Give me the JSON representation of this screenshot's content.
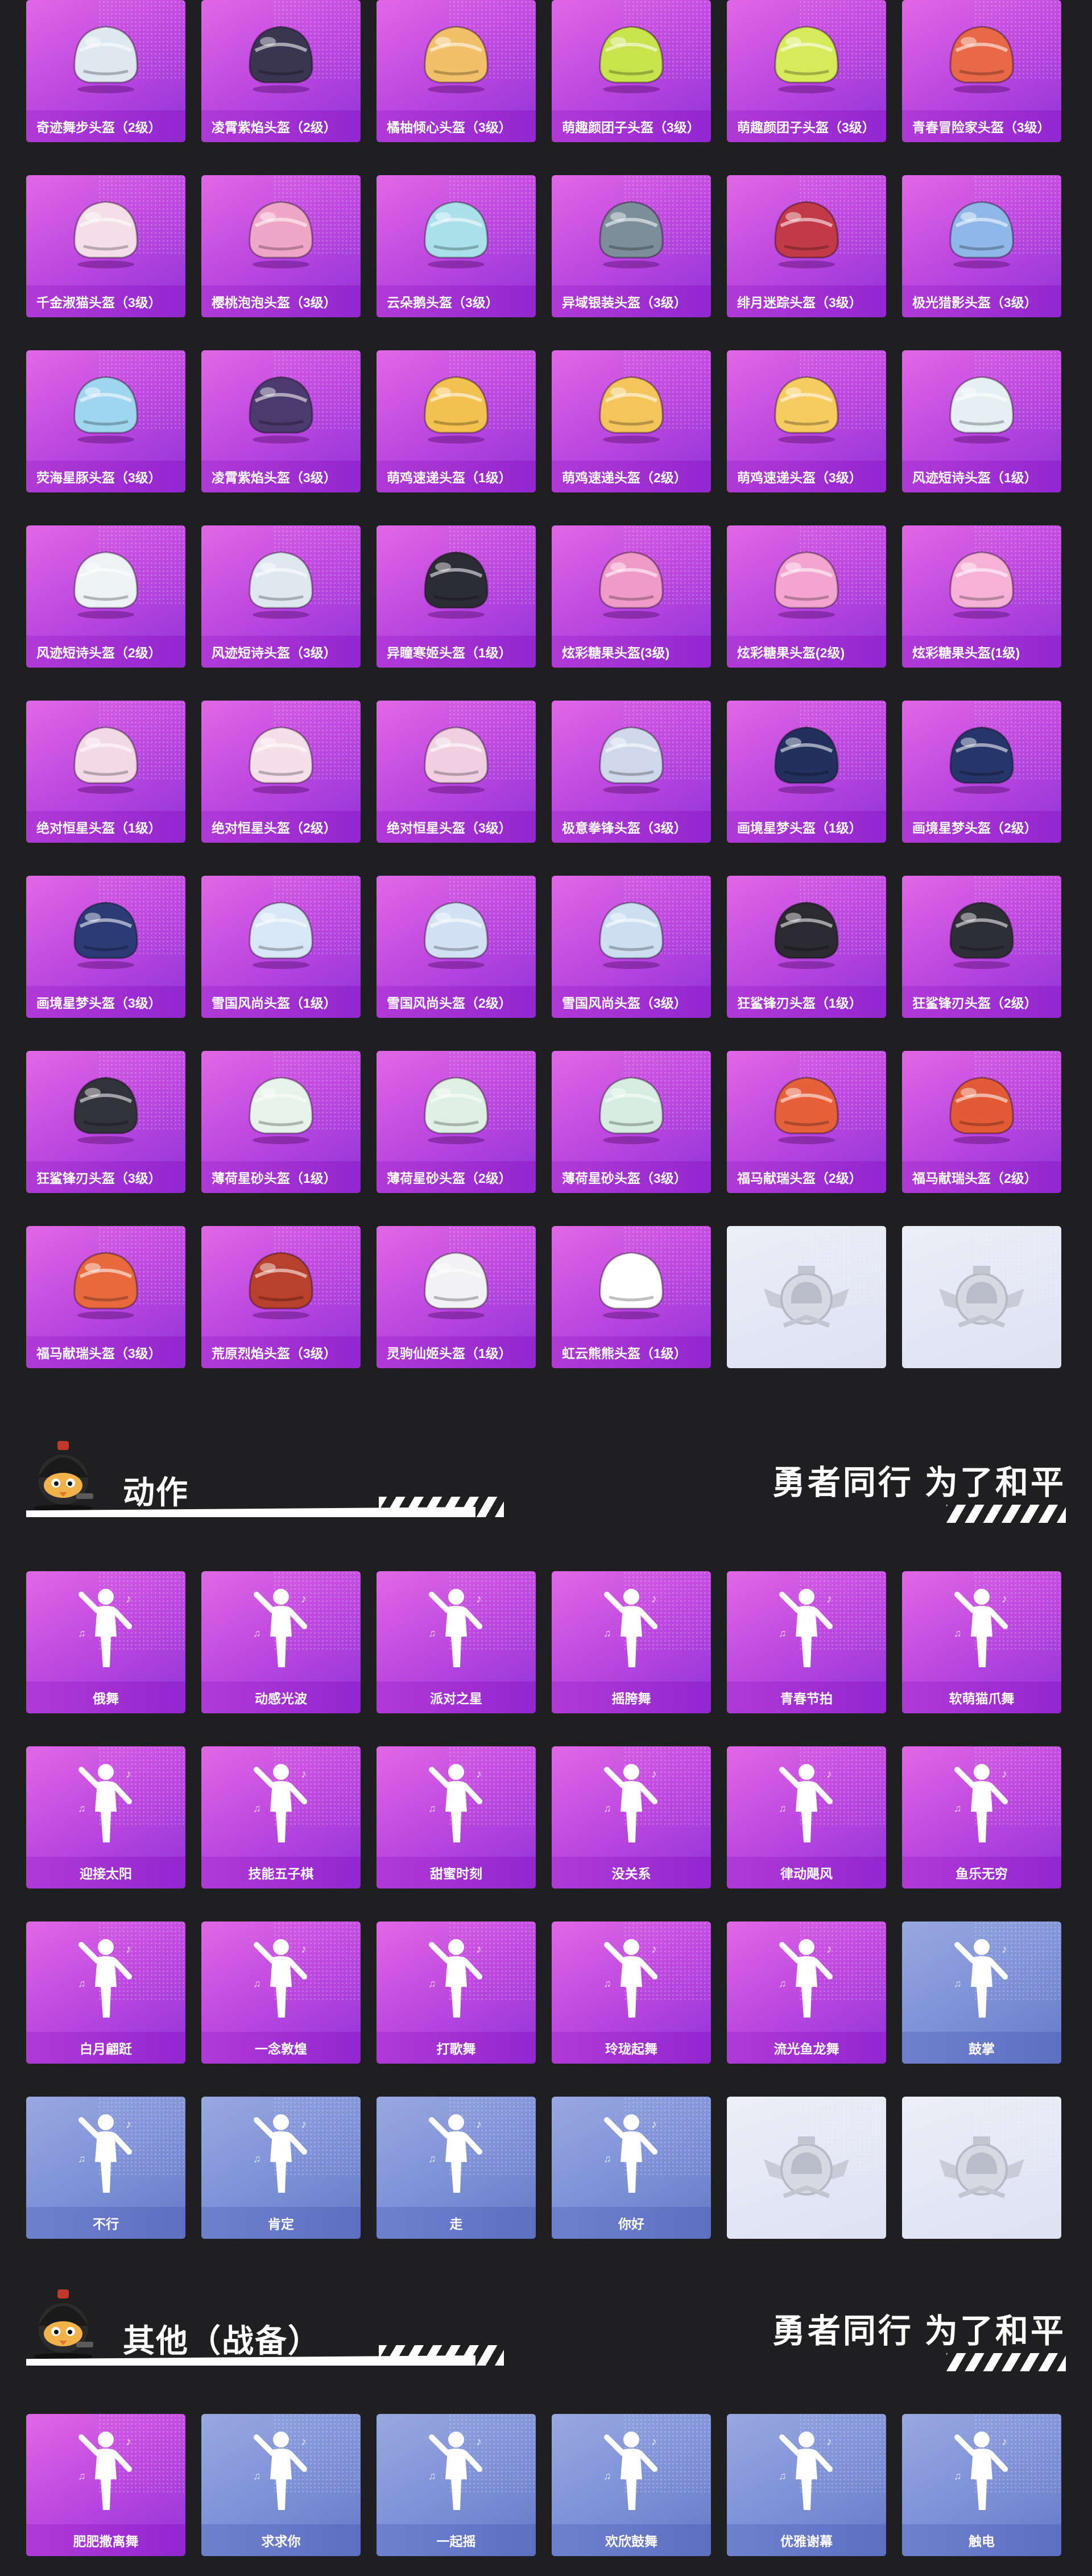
{
  "helmets": [
    {
      "label": "奇迹舞步头盔（2级）",
      "icon": "helmet-icon",
      "color": "#dfe8ef"
    },
    {
      "label": "凌霄紫焰头盔（2级）",
      "icon": "helmet-icon",
      "color": "#3a3550"
    },
    {
      "label": "橘柚倾心头盔（3级）",
      "icon": "helmet-icon",
      "color": "#f3c06a"
    },
    {
      "label": "萌趣颜团子头盔（3级）",
      "icon": "helmet-icon",
      "color": "#c9e34c"
    },
    {
      "label": "萌趣颜团子头盔（3级）",
      "icon": "helmet-icon",
      "color": "#d7ea5a"
    },
    {
      "label": "青春冒险家头盔（3级）",
      "icon": "helmet-icon",
      "color": "#e86848"
    },
    {
      "label": "千金淑猫头盔（3级）",
      "icon": "helmet-icon",
      "color": "#f4dfe8"
    },
    {
      "label": "樱桃泡泡头盔（3级）",
      "icon": "helmet-icon",
      "color": "#f0a6c6"
    },
    {
      "label": "云朵鹅头盔（3级）",
      "icon": "helmet-icon",
      "color": "#a9e0ea"
    },
    {
      "label": "异域银装头盔（3级）",
      "icon": "helmet-icon",
      "color": "#7b8e9a"
    },
    {
      "label": "绯月迷踪头盔（3级）",
      "icon": "helmet-icon",
      "color": "#c23a48"
    },
    {
      "label": "极光猎影头盔（3级）",
      "icon": "helmet-icon",
      "color": "#8fb7e8"
    },
    {
      "label": "荧海星豚头盔（3级）",
      "icon": "helmet-icon",
      "color": "#9fd6ef"
    },
    {
      "label": "凌霄紫焰头盔（3级）",
      "icon": "helmet-icon",
      "color": "#4a3a6e"
    },
    {
      "label": "萌鸡速递头盔（1级）",
      "icon": "helmet-icon",
      "color": "#f2c14f"
    },
    {
      "label": "萌鸡速递头盔（2级）",
      "icon": "helmet-icon",
      "color": "#f4c55a"
    },
    {
      "label": "萌鸡速递头盔（3级）",
      "icon": "helmet-icon",
      "color": "#f6cb60"
    },
    {
      "label": "风迹短诗头盔（1级）",
      "icon": "helmet-icon",
      "color": "#e6f0f2"
    },
    {
      "label": "风迹短诗头盔（2级）",
      "icon": "helmet-icon",
      "color": "#edf2f4"
    },
    {
      "label": "风迹短诗头盔（3级）",
      "icon": "helmet-icon",
      "color": "#dfe8f0"
    },
    {
      "label": "异瞳寒姬头盔（1级）",
      "icon": "helmet-icon",
      "color": "#2c2c34"
    },
    {
      "label": "炫彩糖果头盔(3级)",
      "icon": "helmet-icon",
      "color": "#f09ac8"
    },
    {
      "label": "炫彩糖果头盔(2级)",
      "icon": "helmet-icon",
      "color": "#f3a5cf"
    },
    {
      "label": "炫彩糖果头盔(1级)",
      "icon": "helmet-icon",
      "color": "#f6b1d6"
    },
    {
      "label": "绝对恒星头盔（1级）",
      "icon": "helmet-icon",
      "color": "#f3d9e6"
    },
    {
      "label": "绝对恒星头盔（2级）",
      "icon": "helmet-icon",
      "color": "#f5dfe9"
    },
    {
      "label": "绝对恒星头盔（3级）",
      "icon": "helmet-icon",
      "color": "#f0d0e0"
    },
    {
      "label": "极意拳锋头盔（3级）",
      "icon": "helmet-icon",
      "color": "#cfd8ea"
    },
    {
      "label": "画境星梦头盔（1级）",
      "icon": "helmet-icon",
      "color": "#22305e"
    },
    {
      "label": "画境星梦头盔（2级）",
      "icon": "helmet-icon",
      "color": "#26356a"
    },
    {
      "label": "画境星梦头盔（3级）",
      "icon": "helmet-icon",
      "color": "#2a3b76"
    },
    {
      "label": "雪国风尚头盔（1级）",
      "icon": "helmet-icon",
      "color": "#d8e6f6"
    },
    {
      "label": "雪国风尚头盔（2级）",
      "icon": "helmet-icon",
      "color": "#d2e2f4"
    },
    {
      "label": "雪国风尚头盔（3级）",
      "icon": "helmet-icon",
      "color": "#ccdef2"
    },
    {
      "label": "狂鲨锋刃头盔（1级）",
      "icon": "helmet-icon",
      "color": "#2a2a30"
    },
    {
      "label": "狂鲨锋刃头盔（2级）",
      "icon": "helmet-icon",
      "color": "#2e2e36"
    },
    {
      "label": "狂鲨锋刃头盔（3级）",
      "icon": "helmet-icon",
      "color": "#32323a"
    },
    {
      "label": "薄荷星砂头盔（1级）",
      "icon": "helmet-icon",
      "color": "#e6f2ea"
    },
    {
      "label": "薄荷星砂头盔（2级）",
      "icon": "helmet-icon",
      "color": "#dfefe4"
    },
    {
      "label": "薄荷星砂头盔（3级）",
      "icon": "helmet-icon",
      "color": "#d6ece0"
    },
    {
      "label": "福马献瑞头盔（2级）",
      "icon": "helmet-icon",
      "color": "#e6603a"
    },
    {
      "label": "福马献瑞头盔（2级）",
      "icon": "helmet-icon",
      "color": "#e35a36"
    },
    {
      "label": "福马献瑞头盔（3级）",
      "icon": "helmet-icon",
      "color": "#e86a3c"
    },
    {
      "label": "荒原烈焰头盔（3级）",
      "icon": "helmet-icon",
      "color": "#b8402c"
    },
    {
      "label": "灵驹仙姬头盔（1级）",
      "icon": "helmet-icon",
      "color": "#f2f2f4"
    },
    {
      "label": "虹云熊熊头盔（1级）",
      "icon": "helmet-icon",
      "color": "#ffffff"
    },
    {
      "label": "",
      "icon": "emblem-icon",
      "color": "#c6cad6",
      "blank": true
    },
    {
      "label": "",
      "icon": "emblem-icon",
      "color": "#c6cad6",
      "blank": true
    }
  ],
  "sections": {
    "emotes": {
      "title": "动作",
      "slogan": "勇者同行 为了和平",
      "mascot_icon": "mascot-icon"
    },
    "other": {
      "title": "其他（战备）",
      "slogan": "勇者同行 为了和平",
      "mascot_icon": "mascot-icon"
    }
  },
  "emotes": [
    {
      "label": "俄舞",
      "style": "purple"
    },
    {
      "label": "动感光波",
      "style": "purple"
    },
    {
      "label": "派对之星",
      "style": "purple"
    },
    {
      "label": "摇胯舞",
      "style": "purple"
    },
    {
      "label": "青春节拍",
      "style": "purple"
    },
    {
      "label": "软萌猫爪舞",
      "style": "purple"
    },
    {
      "label": "迎接太阳",
      "style": "purple"
    },
    {
      "label": "技能五子棋",
      "style": "purple"
    },
    {
      "label": "甜蜜时刻",
      "style": "purple"
    },
    {
      "label": "没关系",
      "style": "purple"
    },
    {
      "label": "律动飓风",
      "style": "purple"
    },
    {
      "label": "鱼乐无穷",
      "style": "purple"
    },
    {
      "label": "白月翩跹",
      "style": "purple"
    },
    {
      "label": "一念敦煌",
      "style": "purple"
    },
    {
      "label": "打歌舞",
      "style": "purple"
    },
    {
      "label": "玲珑起舞",
      "style": "purple"
    },
    {
      "label": "流光鱼龙舞",
      "style": "purple"
    },
    {
      "label": "鼓掌",
      "style": "blue"
    },
    {
      "label": "不行",
      "style": "blue"
    },
    {
      "label": "肯定",
      "style": "blue"
    },
    {
      "label": "走",
      "style": "blue"
    },
    {
      "label": "你好",
      "style": "blue"
    },
    {
      "label": "",
      "style": "blank"
    },
    {
      "label": "",
      "style": "blank"
    }
  ],
  "other_items": [
    {
      "label": "肥肥撒离舞",
      "style": "purple"
    },
    {
      "label": "求求你",
      "style": "blue"
    },
    {
      "label": "一起摇",
      "style": "blue"
    },
    {
      "label": "欢欣鼓舞",
      "style": "blue"
    },
    {
      "label": "优雅谢幕",
      "style": "blue"
    },
    {
      "label": "触电",
      "style": "blue"
    }
  ]
}
